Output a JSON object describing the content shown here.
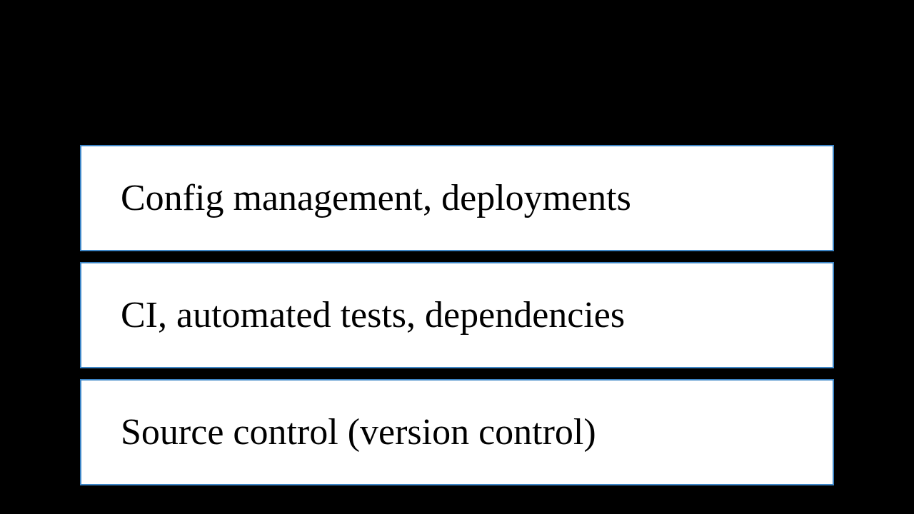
{
  "layers": [
    {
      "label": "Config management, deployments"
    },
    {
      "label": "CI, automated tests, dependencies"
    },
    {
      "label": "Source control (version control)"
    }
  ]
}
